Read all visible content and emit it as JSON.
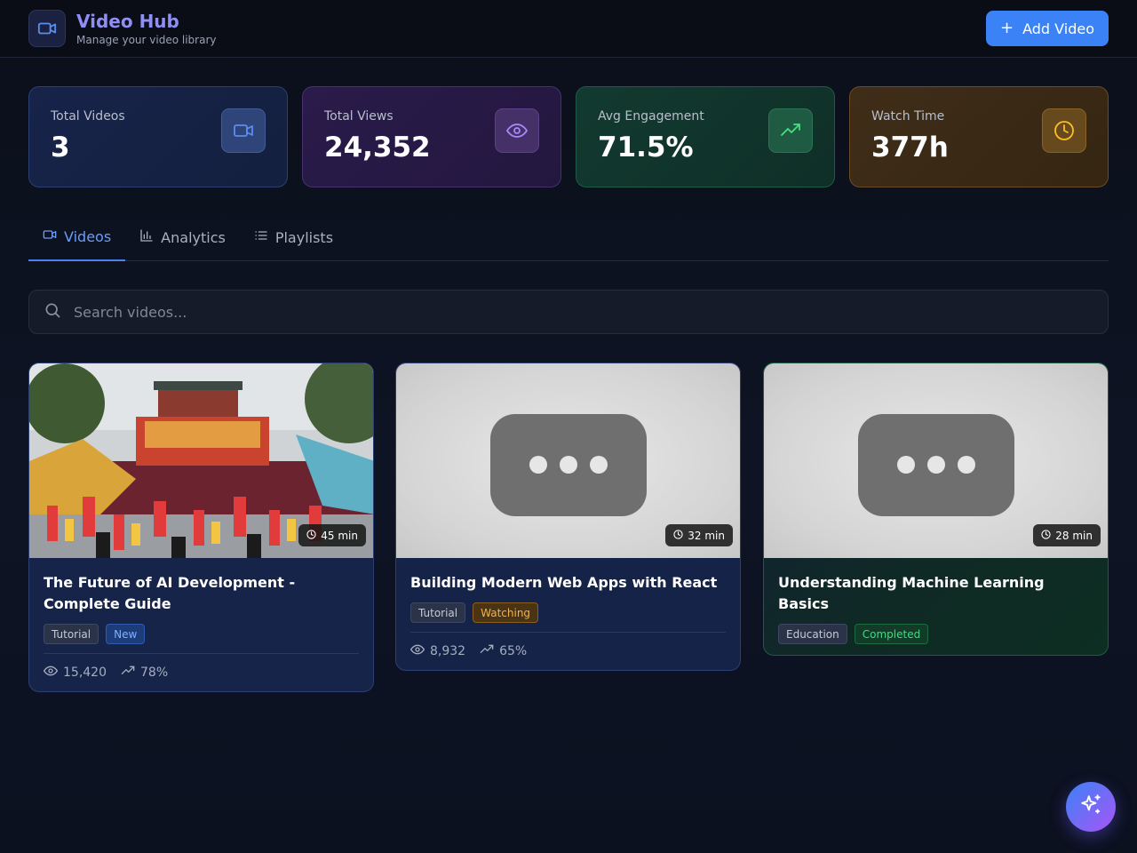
{
  "app": {
    "title": "Video Hub",
    "subtitle": "Manage your video library",
    "add_button_label": "Add Video",
    "add_button_plus": "+"
  },
  "stats": [
    {
      "label": "Total Videos",
      "value": "3",
      "icon": "video-icon",
      "color": "#5b8def"
    },
    {
      "label": "Total Views",
      "value": "24,352",
      "icon": "eye-icon",
      "color": "#a78bfa"
    },
    {
      "label": "Avg Engagement",
      "value": "71.5%",
      "icon": "trending-up-icon",
      "color": "#4ade80"
    },
    {
      "label": "Watch Time",
      "value": "377h",
      "icon": "clock-icon",
      "color": "#fbbf24"
    }
  ],
  "tabs": [
    {
      "label": "Videos",
      "icon": "video-icon",
      "active": true
    },
    {
      "label": "Analytics",
      "icon": "bar-chart-icon",
      "active": false
    },
    {
      "label": "Playlists",
      "icon": "list-icon",
      "active": false
    }
  ],
  "search": {
    "placeholder": "Search videos...",
    "value": ""
  },
  "videos": [
    {
      "title": "The Future of AI Development - Complete Guide",
      "duration": "45 min",
      "tags": [
        "Tutorial",
        "New"
      ],
      "views": "15,420",
      "engagement": "78%",
      "thumbnail": "festival-dancers-photo"
    },
    {
      "title": "Building Modern Web Apps with React",
      "duration": "32 min",
      "tags": [
        "Tutorial",
        "Watching"
      ],
      "views": "8,932",
      "engagement": "65%",
      "thumbnail": "placeholder-video-icon"
    },
    {
      "title": "Understanding Machine Learning Basics",
      "duration": "28 min",
      "tags": [
        "Education",
        "Completed"
      ],
      "thumbnail": "placeholder-video-icon"
    }
  ],
  "fab": {
    "icon": "sparkles-icon"
  }
}
